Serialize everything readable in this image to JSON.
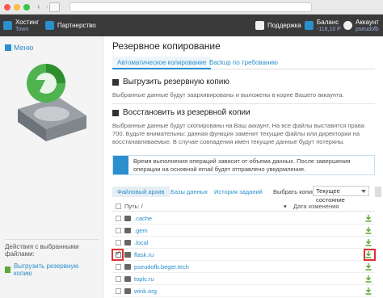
{
  "brand": {
    "top": "Хостинг",
    "bottom": "Town"
  },
  "toolbar": {
    "partnership": "Партнерство",
    "support": "Поддержка",
    "balance_label": "Баланс",
    "balance_value": "-118,10 Р",
    "account_label": "Аккаунт",
    "account_value": "pseudofb"
  },
  "sidebar": {
    "menu_label": "Меню",
    "actions_title": "Действия с выбранными файлами:",
    "download_label": "Выгрузить резервную копию"
  },
  "page": {
    "title": "Резервное копирование",
    "tabs": [
      "Автоматическое копирование",
      "Backup по требованию"
    ],
    "export_title": "Выгрузить резервную копию",
    "export_desc": "Выбранные данные будут заархивированы и выложены в корне Вашего аккаунта.",
    "restore_title": "Восстановить из резервной копии",
    "restore_desc": "Выбранные данные будут скопированы на Ваш аккаунт. На все файлы выставятся права 700. Будьте внимательны: данная функция заменит текущие файлы или директории на восстанавливаемые. В случае совпадения имен текущие данные будут потеряны.",
    "notice": "Время выполнения операций зависит от объема данных. После завершения операции на основной email будет отправлено уведомление."
  },
  "file_tabs": [
    "Файловый архив",
    "Базы данных",
    "История заданий"
  ],
  "backup_select": {
    "label": "Выбрать копию:",
    "value": "Текущее состояние"
  },
  "table": {
    "col_path": "Путь: /",
    "col_date": "Дата изменения",
    "rows": [
      {
        "name": ".cache",
        "checked": false
      },
      {
        "name": ".gem",
        "checked": false
      },
      {
        "name": ".local",
        "checked": false
      },
      {
        "name": "flask.ru",
        "checked": true
      },
      {
        "name": "pseudofb.beget.tech",
        "checked": false
      },
      {
        "name": "toplc.ru",
        "checked": false
      },
      {
        "name": "wink.org",
        "checked": false
      }
    ]
  },
  "colors": {
    "accent": "#2a8fcc",
    "toolbar": "#3a3a3a",
    "download": "#5aa839",
    "highlight": "#e03131"
  }
}
